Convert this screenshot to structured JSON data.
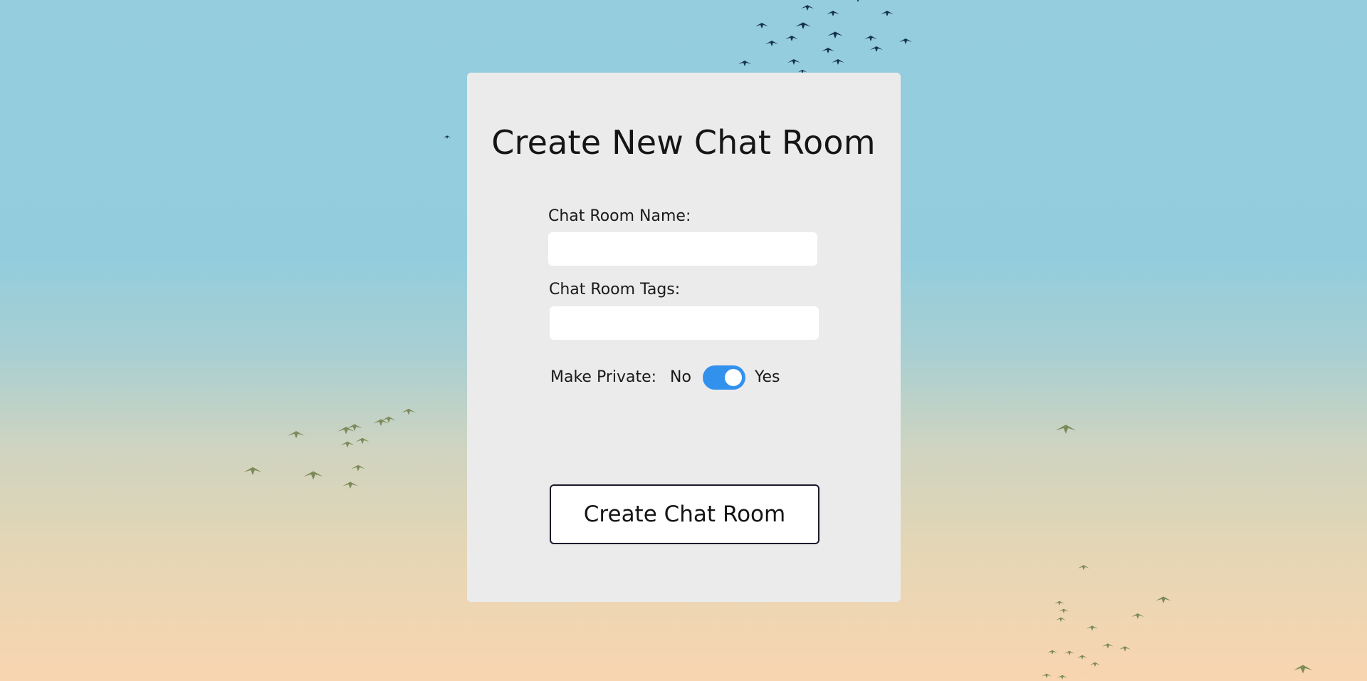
{
  "page": {
    "title": "Create New Chat Room"
  },
  "form": {
    "name_label": "Chat Room Name:",
    "name_value": "",
    "tags_label": "Chat Room Tags:",
    "tags_value": "",
    "private_label": "Make Private:",
    "private_off_label": "No",
    "private_on_label": "Yes",
    "private_enabled": true,
    "submit_label": "Create Chat Room"
  },
  "colors": {
    "sky_top": "#95cddf",
    "sky_bottom": "#f9d5b1",
    "panel": "#ebebeb",
    "toggle_on": "#3391ee",
    "dark_birds": "#16334a",
    "green_birds": "#7d8a5a"
  }
}
